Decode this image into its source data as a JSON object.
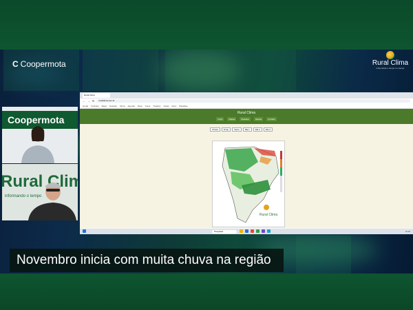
{
  "brand": {
    "coopermota": "Coopermota",
    "rural_clima": "Rural Clima",
    "rural_clima_tagline": "informando o tempo no campo",
    "accent": "#0e5530"
  },
  "webcam_top": {
    "banner": "Coopermota"
  },
  "webcam_bottom": {
    "background_text": "Rural Clima",
    "background_tagline": "informando o tempo"
  },
  "screen": {
    "tab": "Rural Clima",
    "url": "ruralclima.com.br",
    "bookmarks": [
      "Gmail",
      "YouTube",
      "Maps",
      "Notícias",
      "Clima",
      "Agenda",
      "Drive",
      "Fotos",
      "Tradutor",
      "Notas",
      "Docs",
      "Planilhas"
    ],
    "site_title": "Rural Clima",
    "nav": [
      "Início",
      "Mapas",
      "Modelos",
      "Alertas",
      "Contato"
    ],
    "controls": [
      "Chuva",
      "Temp",
      "Vento",
      "Dia 1",
      "Dia 2",
      "Dia 3"
    ],
    "taskbar_search": "Pesquisar",
    "clock": "11:02",
    "map_logo": "Rural Clima"
  },
  "caption": "Novembro inicia com muita chuva na região"
}
